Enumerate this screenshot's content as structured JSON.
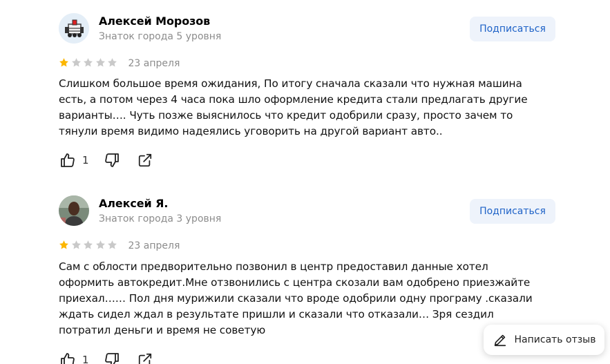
{
  "reviews": [
    {
      "author_name": "Алексей Морозов",
      "author_level": "Знаток города 5 уровня",
      "subscribe_label": "Подписаться",
      "rating": 1,
      "rating_max": 5,
      "date": "23 апреля",
      "text": "Слишком большое время ожидания, По итогу сначала сказали что нужная машина есть, а потом через 4 часа пока шло оформление кредита стали предлагать другие варианты…. Чуть позже выяснилось что кредит одобрили сразу, просто зачем то тянули время видимо надеялись уговорить на другой вариант авто..",
      "likes": "1"
    },
    {
      "author_name": "Алексей Я.",
      "author_level": "Знаток города 3 уровня",
      "subscribe_label": "Подписаться",
      "rating": 1,
      "rating_max": 5,
      "date": "23 апреля",
      "text": "Сам с облости предворительно позвонил в центр предоставил данные хотел оформить автокредит.Мне отзвонились с центра скозали вам одобрено приезжайте приехал…… Пол дня мурижили сказали что вроде одобрили одну програму .сказали ждать сидел ждал в результате пришли и сказали что отказали… Зря сездил потратил деньги и время не советую",
      "likes": "1"
    }
  ],
  "write_review_label": "Написать отзыв",
  "colors": {
    "star_filled": "#fcb600",
    "star_empty": "#c9c9c9",
    "subscribe_bg": "#eef3fb",
    "subscribe_text": "#1e62c7",
    "muted_text": "#8c8c8c"
  }
}
